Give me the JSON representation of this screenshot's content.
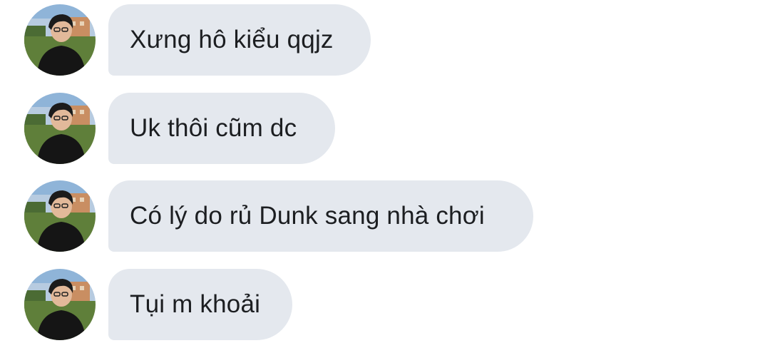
{
  "conversation": {
    "messages": [
      {
        "text": "Xưng hô kiểu qqjz"
      },
      {
        "text": "Uk thôi cũm dc"
      },
      {
        "text": "Có lý do rủ Dunk sang nhà chơi"
      },
      {
        "text": "Tụi m khoải"
      }
    ]
  }
}
